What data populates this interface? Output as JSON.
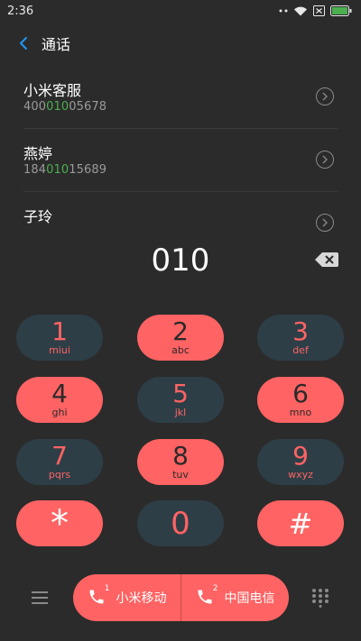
{
  "status_bar": {
    "time": "2:36"
  },
  "header": {
    "title": "通话"
  },
  "contacts": [
    {
      "name": "小米客服",
      "number_pre": "400",
      "number_match": "010",
      "number_post": "05678"
    },
    {
      "name": "燕婷",
      "number_pre": "184",
      "number_match": "010",
      "number_post": "15689"
    },
    {
      "name": "子玲",
      "number_pre": "",
      "number_match": "",
      "number_post": ""
    }
  ],
  "dial": {
    "number": "010"
  },
  "keypad": [
    {
      "digit": "1",
      "letters": "miui"
    },
    {
      "digit": "2",
      "letters": "abc"
    },
    {
      "digit": "3",
      "letters": "def"
    },
    {
      "digit": "4",
      "letters": "ghi"
    },
    {
      "digit": "5",
      "letters": "jkl"
    },
    {
      "digit": "6",
      "letters": "mno"
    },
    {
      "digit": "7",
      "letters": "pqrs"
    },
    {
      "digit": "8",
      "letters": "tuv"
    },
    {
      "digit": "9",
      "letters": "wxyz"
    },
    {
      "digit": "*",
      "letters": ""
    },
    {
      "digit": "0",
      "letters": ""
    },
    {
      "digit": "#",
      "letters": ""
    }
  ],
  "call_buttons": {
    "sim1": {
      "slot": "1",
      "label": "小米移动"
    },
    "sim2": {
      "slot": "2",
      "label": "中国电信"
    }
  },
  "colors": {
    "accent": "#ff6363",
    "key_dark": "#2e3e47",
    "background": "#2b2b2b",
    "match_highlight": "#4caf50",
    "back_arrow": "#2196f3"
  }
}
